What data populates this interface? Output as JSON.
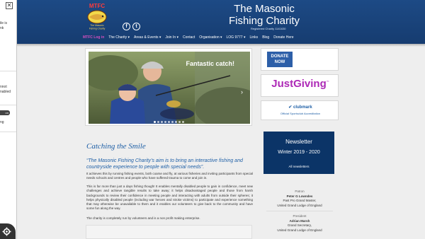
{
  "side_panel": {
    "close_glyph": "✕",
    "fragments": [
      "ile is",
      "nk",
      "nnot",
      "nabled",
      "ng"
    ],
    "pill": "on"
  },
  "header": {
    "logo_text": "MTFC",
    "logo_subtext": "The Masonic Fishing Charity",
    "title_line1": "The Masonic",
    "title_line2": "Fishing Charity",
    "registered": "Registered Charity 1141630",
    "social": [
      "f",
      "t"
    ],
    "nav": {
      "login": "MTFC Log in",
      "items": [
        "The Charity ▾",
        "Areas & Events ▾",
        "Join In ▾",
        "Contact",
        "Organisation ▾",
        "LOG 9777 ▾",
        "Links",
        "Blog",
        "Donate Here"
      ]
    }
  },
  "slider": {
    "caption": "Fantastic catch!",
    "next_glyph": "›",
    "dot_count": 9
  },
  "content": {
    "title": "Catching the Smile",
    "quote": "“The Masonic Fishing Charity’s aim is to bring an interactive fishing and countryside experience to people with special needs”.",
    "paragraphs": [
      "It achieves this by running fishing events, both coarse and fly, at various fisheries and inviting participants from special needs schools and centres and people who have suffered trauma to come and join in.",
      "This is far more than just a days fishing though! It enables mentally disabled people to gain in confidence, meet new challenges and achieve tangible results to take away; it helps disadvantaged people and those from harsh backgrounds to review their confidence in meeting people and interacting with adults from outside their spheres; it helps physically disabled people (including war heroes and stroke victims) to participate and experience something that may otherwise be unavailable to them and it enables our volunteers to give back to the community and have some fun along the way.",
      "The charity is completely run by volunteers and is a non profit making enterprise."
    ]
  },
  "sidebar": {
    "donate_line1": "DONATE",
    "donate_line2": "NOW",
    "justgiving": "JustGiving",
    "justgiving_tm": "™",
    "clubmark": "clubmark",
    "clubmark_sub": "Official Sportsclub Accreditation",
    "newsletter_title": "Newsletter",
    "newsletter_date": "Winter 2019 - 2020",
    "newsletter_link": "All newsletters",
    "people": [
      {
        "role": "Patron",
        "name": "Peter G Lowndes",
        "line1": "Past Pro Grand Master,",
        "line2": "United Grand Lodge of England"
      },
      {
        "role": "President",
        "name": "Adrian Marsh",
        "line1": "Grand Secretary,",
        "line2": "United Grand Lodge of England"
      }
    ]
  },
  "colors": {
    "header": "#1d4a85",
    "accent": "#1e5fa6",
    "login": "#d64fbf",
    "justgiving": "#ad29b6",
    "newsletter_bg": "#0b3467"
  }
}
